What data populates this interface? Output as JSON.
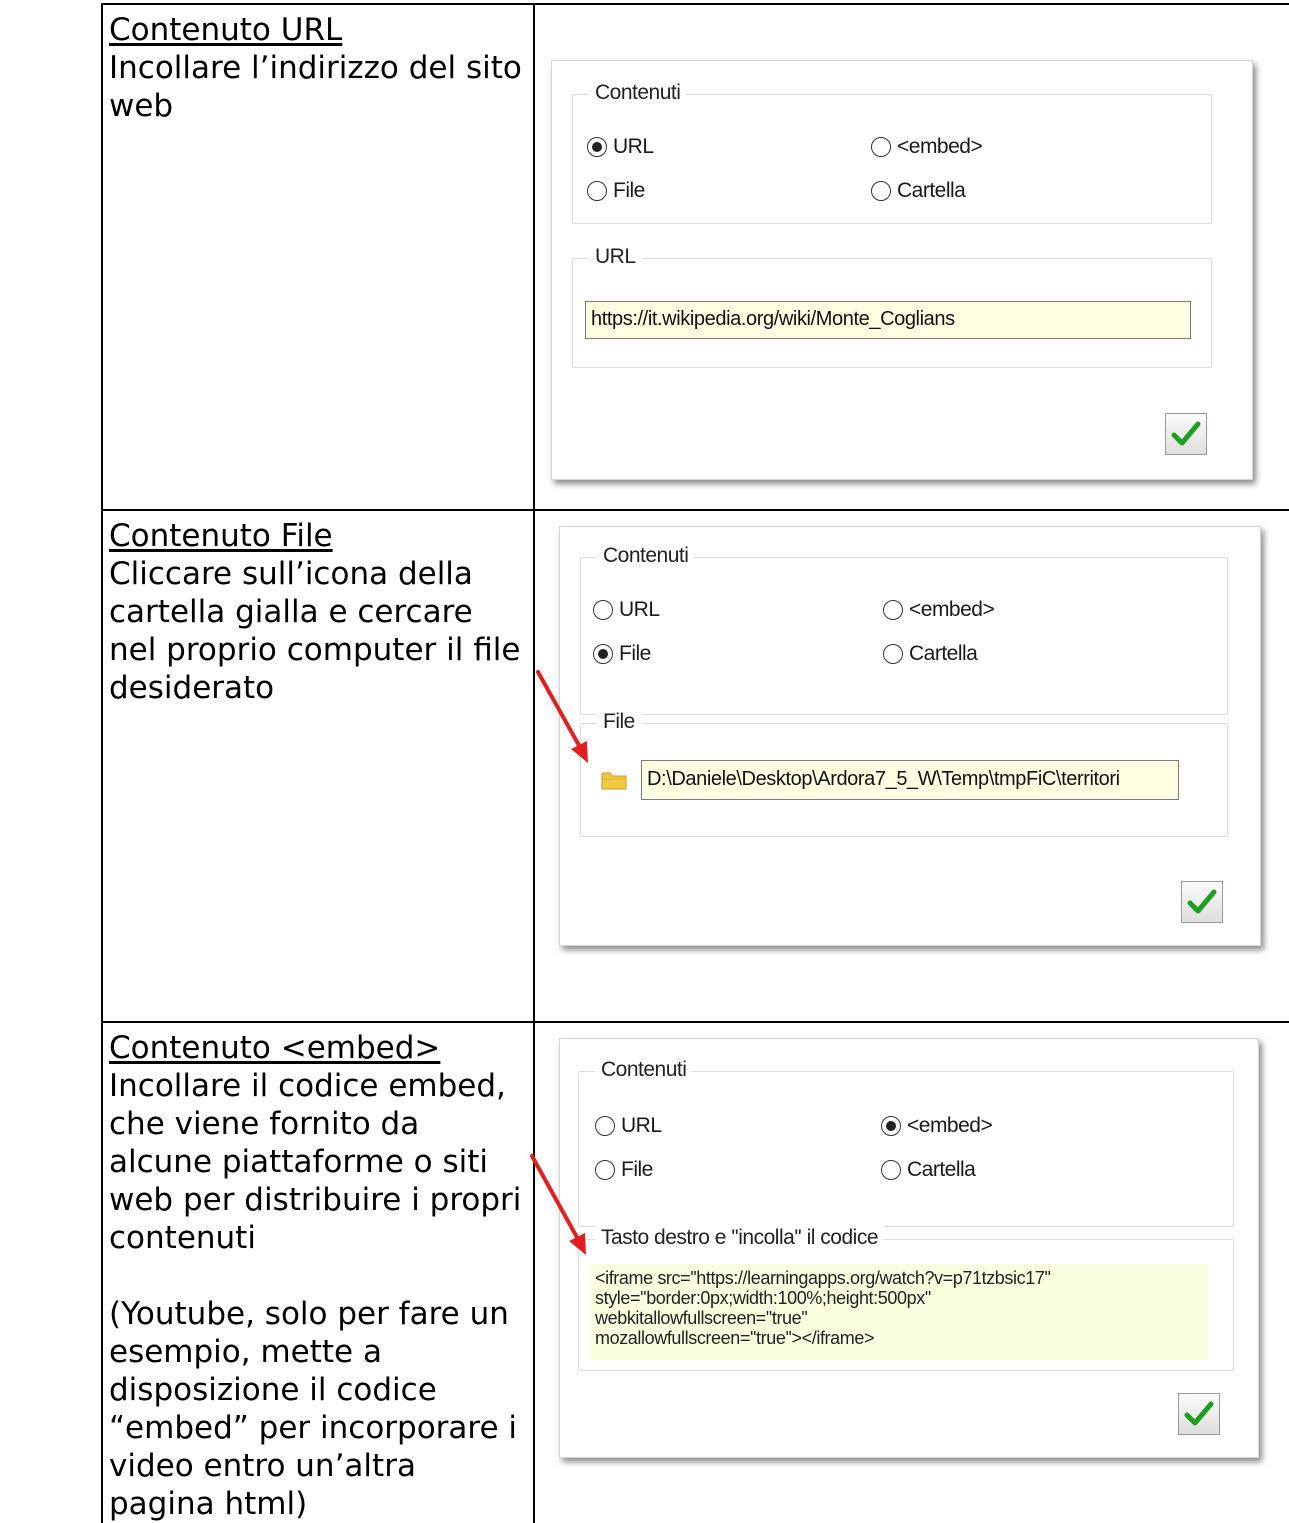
{
  "rows": [
    {
      "heading": "Contenuto URL",
      "text": "Incollare l’indirizzo del sito web",
      "dialog": {
        "group_title": "Contenuti",
        "options": {
          "url": "URL",
          "embed": "<embed>",
          "file": "File",
          "cartella": "Cartella"
        },
        "selected": "url",
        "field_title": "URL",
        "field_value": "https://it.wikipedia.org/wiki/Monte_Coglians"
      }
    },
    {
      "heading": "Contenuto File",
      "text": "Cliccare sull’icona della cartella gialla e cercare nel proprio computer il file desiderato",
      "dialog": {
        "group_title": "Contenuti",
        "options": {
          "url": "URL",
          "embed": "<embed>",
          "file": "File",
          "cartella": "Cartella"
        },
        "selected": "file",
        "field_title": "File",
        "field_value": "D:\\Daniele\\Desktop\\Ardora7_5_W\\Temp\\tmpFiC\\territori"
      }
    },
    {
      "heading": "Contenuto <embed>",
      "text": "Incollare il codice embed, che viene fornito da alcune piattaforme o siti web per distribuire i propri contenuti",
      "text2": "(Youtube, solo per fare un esempio, mette a disposizione il codice “embed” per incorporare i video entro un’altra pagina html)",
      "dialog": {
        "group_title": "Contenuti",
        "options": {
          "url": "URL",
          "embed": "<embed>",
          "file": "File",
          "cartella": "Cartella"
        },
        "selected": "embed",
        "field_title": "Tasto destro e ''incolla'' il codice",
        "code_lines": [
          "<iframe src=''https://learningapps.org/watch?v=p71tzbsic17''",
          "style=''border:0px;width:100%;height:500px''",
          "webkitallowfullscreen=''true''",
          "mozallowfullscreen=''true''></iframe>"
        ]
      }
    }
  ],
  "colors": {
    "field_bg": "#ffffe1",
    "check_green": "#1e9e1e",
    "arrow_red": "#e02020",
    "folder_yellow": "#f5c842"
  },
  "icons": {
    "ok": "checkmark-icon",
    "folder": "folder-icon",
    "arrow": "red-arrow-icon"
  }
}
